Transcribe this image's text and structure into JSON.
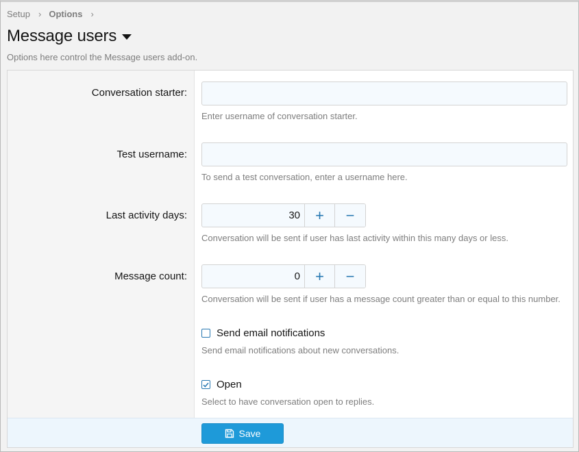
{
  "breadcrumb": {
    "items": [
      "Setup",
      "Options"
    ],
    "separator": "›"
  },
  "page": {
    "title": "Message users",
    "description": "Options here control the Message users add-on."
  },
  "fields": {
    "conversation_starter": {
      "label": "Conversation starter:",
      "value": "",
      "hint": "Enter username of conversation starter."
    },
    "test_username": {
      "label": "Test username:",
      "value": "",
      "hint": "To send a test conversation, enter a username here."
    },
    "last_activity_days": {
      "label": "Last activity days:",
      "value": "30",
      "plus": "+",
      "minus": "−",
      "hint": "Conversation will be sent if user has last activity within this many days or less."
    },
    "message_count": {
      "label": "Message count:",
      "value": "0",
      "plus": "+",
      "minus": "−",
      "hint": "Conversation will be sent if user has a message count greater than or equal to this number."
    },
    "send_email": {
      "label": "Send email notifications",
      "checked": false,
      "hint": "Send email notifications about new conversations."
    },
    "open": {
      "label": "Open",
      "checked": true,
      "hint": "Select to have conversation open to replies."
    }
  },
  "footer": {
    "save_label": "Save"
  },
  "colors": {
    "accent": "#1e9ad9",
    "link_blue": "#2577b1",
    "input_bg": "#f5fafe",
    "footer_bg": "#edf6fd"
  },
  "icons": {
    "title_dropdown": "caret-down-icon",
    "save": "floppy-disk-icon",
    "plus": "plus-icon",
    "minus": "minus-icon",
    "check": "checkmark-icon"
  }
}
